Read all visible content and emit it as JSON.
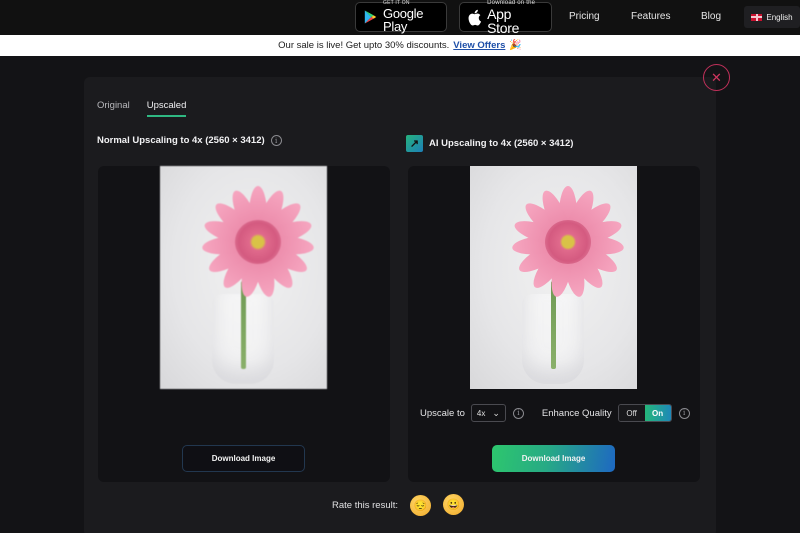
{
  "topnav": {
    "google_play": {
      "small": "GET IT ON",
      "big": "Google Play"
    },
    "app_store": {
      "small": "Download on the",
      "big": "App Store"
    },
    "links": [
      "Pricing",
      "Features",
      "Blog"
    ],
    "language": "English"
  },
  "banner": {
    "text": "Our sale is live! Get upto 30% discounts.",
    "link": "View Offers",
    "emoji": "🎉"
  },
  "modal": {
    "close_glyph": "✕",
    "tabs": [
      {
        "label": "Original",
        "active": false
      },
      {
        "label": "Upscaled",
        "active": true
      }
    ],
    "left_panel": {
      "title": "Normal Upscaling to 4x (2560 × 3412)",
      "download_label": "Download Image"
    },
    "right_panel": {
      "title": "AI Upscaling to 4x (2560 × 3412)",
      "upscale_label": "Upscale to",
      "upscale_value": "4x",
      "enhance_label": "Enhance Quality",
      "toggle_off": "Off",
      "toggle_on": "On",
      "enhance_state": "On",
      "download_label": "Download Image"
    },
    "rating": {
      "label": "Rate this result:",
      "options": [
        "😔",
        "😀"
      ]
    }
  },
  "colors": {
    "accent_green": "#2fb882",
    "accent_blue": "#1e68c2",
    "close_red": "#d0365f"
  }
}
